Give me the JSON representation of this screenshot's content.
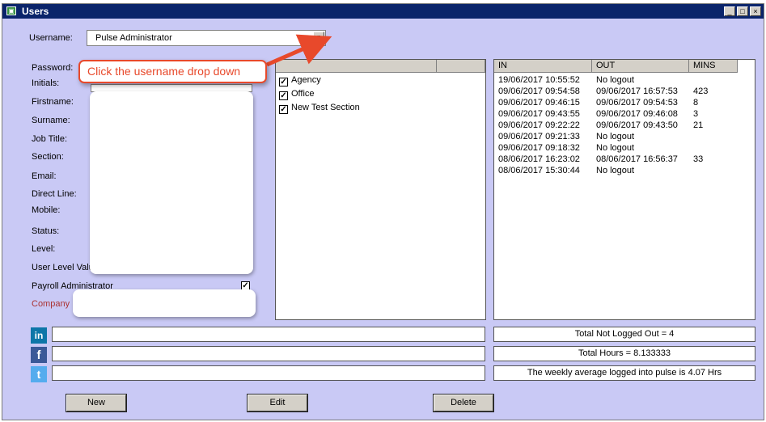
{
  "window": {
    "title": "Users"
  },
  "labels": {
    "username": "Username:",
    "password": "Password:",
    "initials": "Initials:",
    "firstname": "Firstname:",
    "surname": "Surname:",
    "job_title": "Job Title:",
    "section": "Section:",
    "email": "Email:",
    "direct_line": "Direct Line:",
    "mobile": "Mobile:",
    "status": "Status:",
    "level": "Level:",
    "user_level_value": "User Level Valu",
    "payroll_admin": "Payroll Administrator",
    "company": "Company"
  },
  "username": {
    "value": "Pulse Administrator"
  },
  "payroll_admin_checked": true,
  "callout": {
    "text": "Click the username drop down",
    "color": "#e8492b"
  },
  "sections": [
    {
      "label": "Agency",
      "checked": true
    },
    {
      "label": "Office",
      "checked": true
    },
    {
      "label": "New Test Section",
      "checked": true
    }
  ],
  "logins": {
    "columns": [
      "IN",
      "OUT",
      "MINS"
    ],
    "rows": [
      {
        "in": "19/06/2017 10:55:52",
        "out": "No logout",
        "mins": ""
      },
      {
        "in": "09/06/2017 09:54:58",
        "out": "09/06/2017 16:57:53",
        "mins": "423"
      },
      {
        "in": "09/06/2017 09:46:15",
        "out": "09/06/2017 09:54:53",
        "mins": "8"
      },
      {
        "in": "09/06/2017 09:43:55",
        "out": "09/06/2017 09:46:08",
        "mins": "3"
      },
      {
        "in": "09/06/2017 09:22:22",
        "out": "09/06/2017 09:43:50",
        "mins": "21"
      },
      {
        "in": "09/06/2017 09:21:33",
        "out": "No logout",
        "mins": ""
      },
      {
        "in": "09/06/2017 09:18:32",
        "out": "No logout",
        "mins": ""
      },
      {
        "in": "08/06/2017 16:23:02",
        "out": "08/06/2017 16:56:37",
        "mins": "33"
      },
      {
        "in": "08/06/2017 15:30:44",
        "out": "No logout",
        "mins": ""
      }
    ]
  },
  "summary": {
    "not_logged_out": "Total Not Logged Out = 4",
    "total_hours": "Total Hours = 8.133333",
    "weekly_average": "The weekly average logged into pulse is 4.07 Hrs"
  },
  "social": [
    {
      "name": "linkedin",
      "glyph": "in",
      "color": "#0e76a8"
    },
    {
      "name": "facebook",
      "glyph": "f",
      "color": "#3b5998"
    },
    {
      "name": "twitter",
      "glyph": "t",
      "color": "#55acee"
    }
  ],
  "buttons": {
    "new": "New",
    "edit": "Edit",
    "delete": "Delete"
  },
  "win_controls": {
    "minimize": "_",
    "maximize": "□",
    "close": "×"
  }
}
